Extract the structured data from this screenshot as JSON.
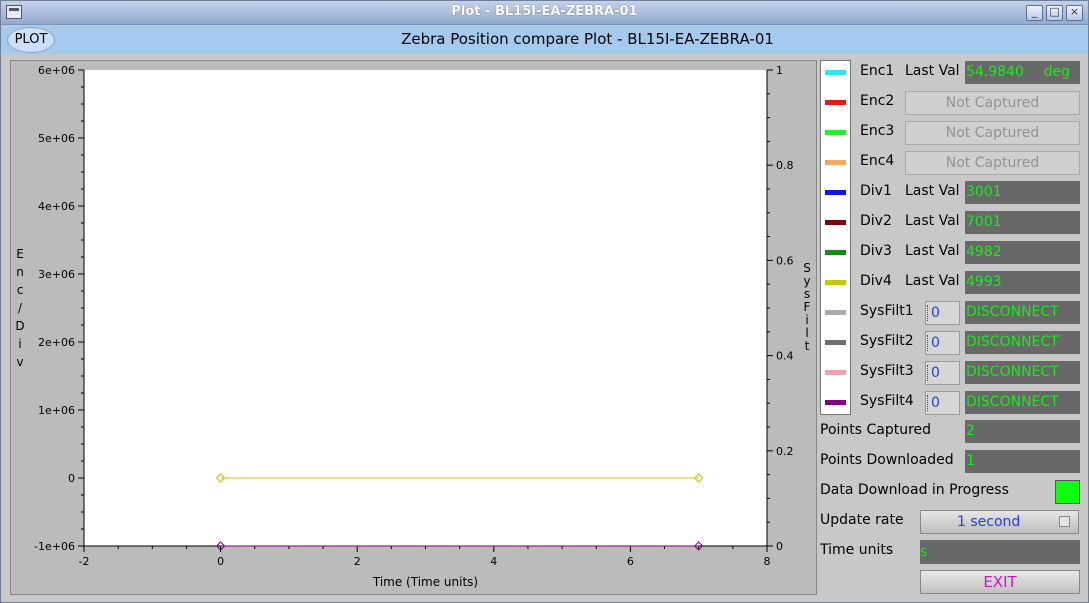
{
  "window": {
    "title": "Plot - BL15I-EA-ZEBRA-01"
  },
  "header": {
    "plot_button": "PLOT",
    "title": "Zebra Position compare Plot - BL15I-EA-ZEBRA-01"
  },
  "chart_data": {
    "type": "line",
    "xlabel": "Time (Time units)",
    "ylabel": "Enc / Div",
    "y2label": "SysFilt",
    "xlim": [
      -2,
      8
    ],
    "ylim": [
      -1000000,
      6000000
    ],
    "y2lim": [
      0,
      1
    ],
    "x_ticks": [
      -2,
      0,
      2,
      4,
      6,
      8
    ],
    "y_ticks": [
      -1000000,
      0,
      1000000,
      2000000,
      3000000,
      4000000,
      5000000,
      6000000
    ],
    "y_tick_labels": [
      "-1e+06",
      "0",
      "1e+06",
      "2e+06",
      "3e+06",
      "4e+06",
      "5e+06",
      "6e+06"
    ],
    "y2_ticks": [
      0,
      0.2,
      0.4,
      0.6,
      0.8,
      1
    ],
    "y2_tick_labels": [
      "0",
      "0.2",
      "0.4",
      "0.6",
      "0.8",
      "1"
    ],
    "series": [
      {
        "name": "Div4",
        "color": "#c8c800",
        "x": [
          0,
          7
        ],
        "y": [
          0,
          0
        ]
      },
      {
        "name": "SysFilt4",
        "color": "#800080",
        "axis": "y2",
        "x": [
          0,
          7
        ],
        "y": [
          0,
          0
        ]
      }
    ]
  },
  "legend": {
    "rows": [
      {
        "name": "Enc1",
        "color": "#2ee6ee",
        "kind": "val",
        "label": "Last Val",
        "value": "54.9840",
        "unit": "deg"
      },
      {
        "name": "Enc2",
        "color": "#ee1515",
        "kind": "nc",
        "value": "Not Captured"
      },
      {
        "name": "Enc3",
        "color": "#25ee25",
        "kind": "nc",
        "value": "Not Captured"
      },
      {
        "name": "Enc4",
        "color": "#f5a860",
        "kind": "nc",
        "value": "Not Captured"
      },
      {
        "name": "Div1",
        "color": "#1515ee",
        "kind": "val",
        "label": "Last Val",
        "value": "3001"
      },
      {
        "name": "Div2",
        "color": "#780a0a",
        "kind": "val",
        "label": "Last Val",
        "value": "7001"
      },
      {
        "name": "Div3",
        "color": "#178a17",
        "kind": "val",
        "label": "Last Val",
        "value": "4982"
      },
      {
        "name": "Div4",
        "color": "#c8c800",
        "kind": "val",
        "label": "Last Val",
        "value": "4993"
      },
      {
        "name": "SysFilt1",
        "color": "#aaaaaa",
        "kind": "sys",
        "spin": "0",
        "value": "DISCONNECT"
      },
      {
        "name": "SysFilt2",
        "color": "#6e6e6e",
        "kind": "sys",
        "spin": "0",
        "value": "DISCONNECT"
      },
      {
        "name": "SysFilt3",
        "color": "#f5a0b0",
        "kind": "sys",
        "spin": "0",
        "value": "DISCONNECT"
      },
      {
        "name": "SysFilt4",
        "color": "#800080",
        "kind": "sys",
        "spin": "0",
        "value": "DISCONNECT"
      }
    ]
  },
  "status": {
    "points_captured_label": "Points Captured",
    "points_captured": "2",
    "points_downloaded_label": "Points Downloaded",
    "points_downloaded": "1",
    "download_label": "Data Download in Progress",
    "download_color": "#10ff10",
    "update_rate_label": "Update rate",
    "update_rate": "1 second",
    "time_units_label": "Time units",
    "time_units": "s",
    "exit_label": "EXIT"
  }
}
